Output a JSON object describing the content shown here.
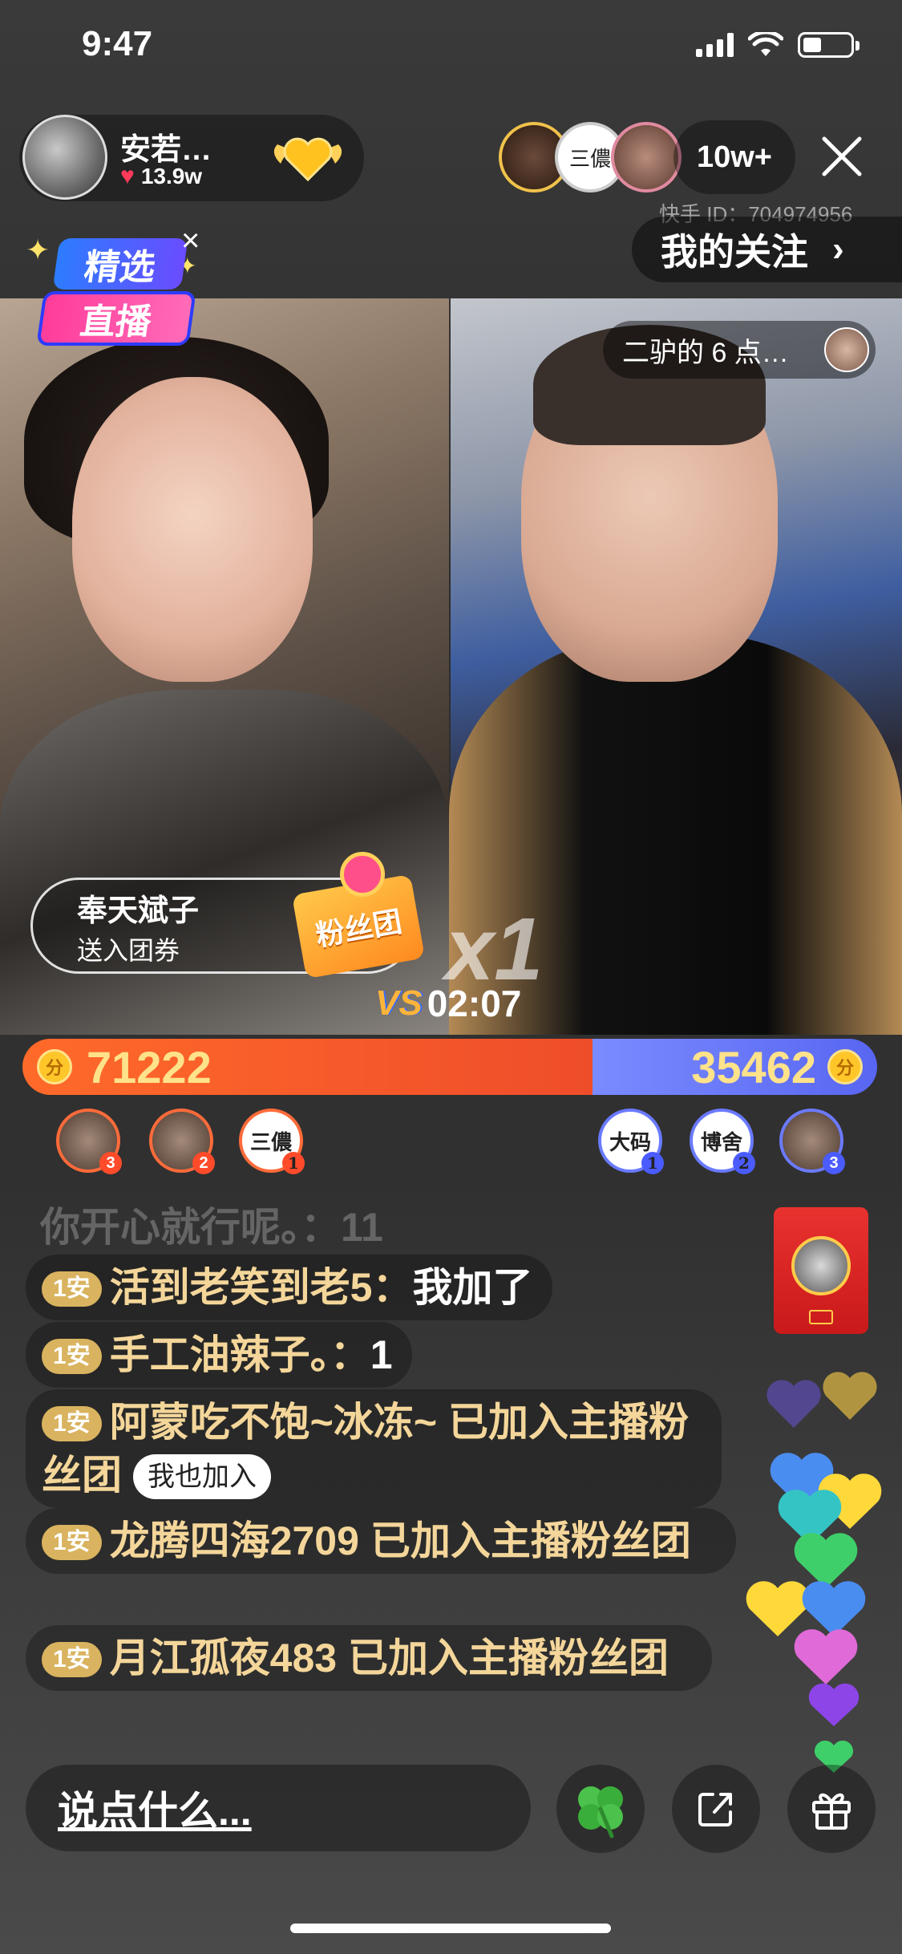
{
  "status": {
    "time": "9:47"
  },
  "anchor": {
    "name": "安若…",
    "likes": "13.9w"
  },
  "viewers": {
    "count": "10w+",
    "avatar2_text": "三儂"
  },
  "kuaishou_id": "快手 ID：704974956",
  "follow_button": {
    "label": "我的关注",
    "chevron": "›"
  },
  "featured_badge": {
    "line1": "精选",
    "line2": "直播"
  },
  "pk": {
    "partner_name": "二驴的 6 点…",
    "timer": "02:07",
    "vs_label": "VS",
    "multiplier": "x1",
    "left_score": "71222",
    "right_score": "35462",
    "left_ratio": 0.667,
    "coin_label": "分"
  },
  "gift_notice": {
    "sender": "奉天斌子",
    "action": "送入团券",
    "badge": "粉丝团"
  },
  "contributors": {
    "left": [
      {
        "rank": "3"
      },
      {
        "rank": "2"
      },
      {
        "rank": "1",
        "text": "三儂"
      }
    ],
    "right": [
      {
        "rank": "1",
        "text": "大码"
      },
      {
        "rank": "2",
        "text": "博舍"
      },
      {
        "rank": "3"
      }
    ]
  },
  "chat": {
    "faded": "你开心就行呢。：11",
    "level_label": "1安",
    "messages": [
      {
        "user": "活到老笑到老5：",
        "text": "我加了"
      },
      {
        "user": "手工油辣子。：",
        "text": "1"
      },
      {
        "user": "阿蒙吃不饱~冰冻~",
        "text": "已加入主播粉丝团",
        "button": "我也加入"
      },
      {
        "user": "龙腾四海2709",
        "text": "已加入主播粉丝团"
      },
      {
        "user": "月江孤夜483",
        "text": "已加入主播粉丝团"
      }
    ]
  },
  "input": {
    "placeholder": "说点什么..."
  },
  "icons": {
    "clover": "clover-icon",
    "share": "share-icon",
    "gift": "gift-icon",
    "close": "close-icon",
    "heart": "heart-icon"
  },
  "colors": {
    "left_team": "#ef4d2a",
    "right_team": "#5866f2",
    "chat_gold": "#f4d69a",
    "level_badge": "#d9b35f"
  }
}
